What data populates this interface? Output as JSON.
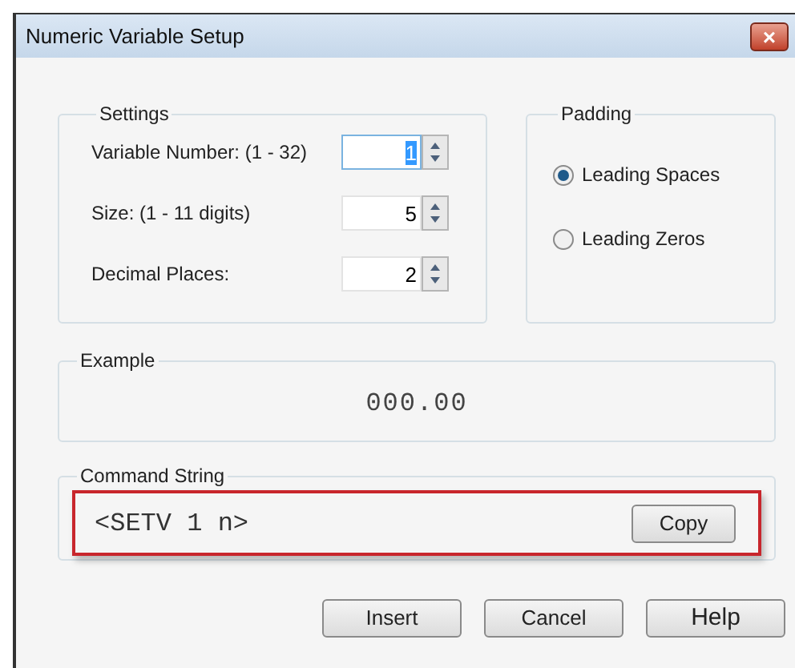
{
  "window": {
    "title": "Numeric Variable Setup",
    "close": "×"
  },
  "settings": {
    "title": "Settings",
    "fields": [
      {
        "label": "Variable Number: (1 - 32)",
        "value": "1",
        "focused": true
      },
      {
        "label": "Size: (1 - 11 digits)",
        "value": "5",
        "focused": false
      },
      {
        "label": "Decimal Places:",
        "value": "2",
        "focused": false
      }
    ]
  },
  "padding": {
    "title": "Padding",
    "options": [
      {
        "label": "Leading Spaces",
        "selected": true
      },
      {
        "label": "Leading Zeros",
        "selected": false
      }
    ]
  },
  "example": {
    "title": "Example",
    "value": "000.00"
  },
  "command": {
    "title": "Command String",
    "value": "<SETV 1 n>",
    "highlighted": true,
    "copy": "Copy"
  },
  "buttons": [
    "Insert",
    "Cancel",
    "Help"
  ]
}
